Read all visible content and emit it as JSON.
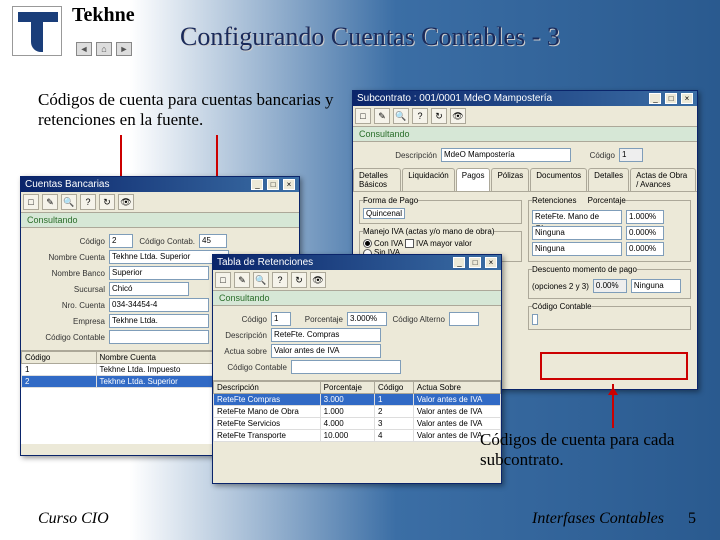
{
  "company": "Tekhne",
  "title": "Configurando Cuentas Contables - 3",
  "caption_left": "Códigos de cuenta para cuentas bancarias y retenciones en la fuente.",
  "caption_right": "Códigos de cuenta para cada subcontrato.",
  "footer_left": "Curso CIO",
  "footer_right": "Interfases Contables",
  "page_number": "5",
  "win1": {
    "title": "Cuentas Bancarias",
    "status": "Consultando",
    "fields": {
      "codigo_lbl": "Código",
      "codigo_val": "2",
      "codigo_cont_lbl": "Código Contab.",
      "codigo_cont_val": "45",
      "nombre_cuenta_lbl": "Nombre Cuenta",
      "nombre_cuenta_val": "Tekhne Ltda. Superior",
      "nombre_banco_lbl": "Nombre Banco",
      "nombre_banco_val": "Superior",
      "sucursal_lbl": "Sucursal",
      "sucursal_val": "Chicó",
      "nro_cuenta_lbl": "Nro. Cuenta",
      "nro_cuenta_val": "034-34454-4",
      "empresa_lbl": "Empresa",
      "empresa_val": "Tekhne Ltda.",
      "codigo_contable_lbl": "Código Contable"
    },
    "list": {
      "headers": [
        "Código",
        "Nombre Cuenta"
      ],
      "rows": [
        [
          "1",
          "Tekhne Ltda. Impuesto"
        ],
        [
          "2",
          "Tekhne Ltda. Superior"
        ]
      ]
    }
  },
  "win2": {
    "title": "Tabla de Retenciones",
    "status": "Consultando",
    "fields": {
      "codigo_lbl": "Código",
      "codigo_val": "1",
      "porcentaje_lbl": "Porcentaje",
      "porcentaje_val": "3.000%",
      "codigo_alt_lbl": "Código Alterno",
      "descripcion_lbl": "Descripción",
      "descripcion_val": "ReteFte. Compras",
      "actua_lbl": "Actua sobre",
      "actua_val": "Valor antes de IVA",
      "codigo_cont_lbl": "Código Contable"
    },
    "table": {
      "headers": [
        "Descripción",
        "Porcentaje",
        "Código",
        "Actua Sobre"
      ],
      "rows": [
        [
          "ReteFte Compras",
          "3.000",
          "1",
          "Valor antes de IVA"
        ],
        [
          "ReteFte Mano de Obra",
          "1.000",
          "2",
          "Valor antes de IVA"
        ],
        [
          "ReteFte Servicios",
          "4.000",
          "3",
          "Valor antes de IVA"
        ],
        [
          "ReteFte Transporte",
          "10.000",
          "4",
          "Valor antes de IVA"
        ]
      ]
    }
  },
  "win3": {
    "title": "Subcontrato : 001/0001 MdeO Mampostería",
    "status": "Consultando",
    "desc_lbl": "Descripción",
    "desc_val": "MdeO Mampostería",
    "codigo_lbl": "Código",
    "codigo_val": "1",
    "tabs": [
      "Detalles Básicos",
      "Liquidación",
      "Pagos",
      "Pólizas",
      "Documentos",
      "Detalles",
      "Actas de Obra / Avances"
    ],
    "active_tab": "Pagos",
    "forma_pago_lbl": "Forma de Pago",
    "forma_pago_val": "Quincenal",
    "retenciones_lbl": "Retenciones",
    "porcentaje_lbl": "Porcentaje",
    "ret_rows": [
      {
        "name": "ReteFte. Mano de Obra",
        "pct": "1.000%"
      },
      {
        "name": "Ninguna",
        "pct": "0.000%"
      },
      {
        "name": "Ninguna",
        "pct": "0.000%"
      }
    ],
    "iva_lbl": "Manejo IVA (actas y/o mano de obra)",
    "iva_opt1": "Con IVA",
    "iva_opt2": "Sin IVA",
    "iva_mayor_lbl": "IVA mayor valor",
    "desc_linea_lbl": "Descuento momento de pago",
    "desc_linea_opt": "(opciones 2 y 3)",
    "desc_linea_val": "0.00%",
    "desc_dropdown": "Ninguna",
    "cc_lbl": "Código Contable"
  }
}
